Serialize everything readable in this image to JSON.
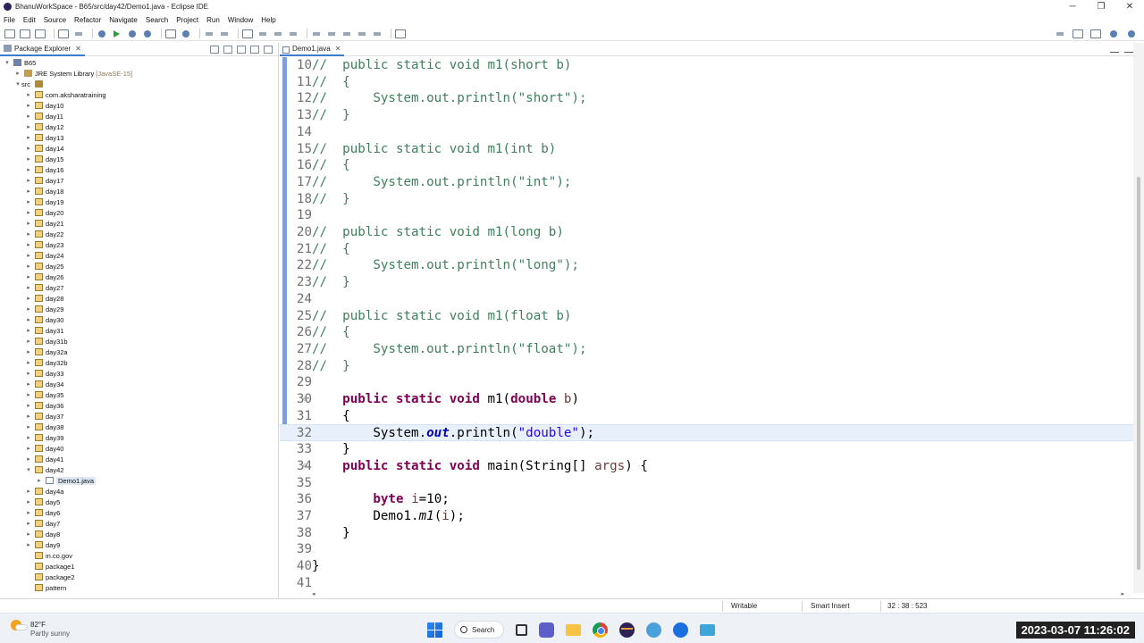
{
  "window": {
    "title": "BhanuWorkSpace - B65/src/day42/Demo1.java - Eclipse IDE",
    "controls": [
      "─",
      "❐",
      "✕"
    ]
  },
  "menu": [
    "File",
    "Edit",
    "Source",
    "Refactor",
    "Navigate",
    "Search",
    "Project",
    "Run",
    "Window",
    "Help"
  ],
  "explorer": {
    "tab_label": "Package Explorer",
    "close": "✕",
    "tree": [
      {
        "label": "B65",
        "depth": 0,
        "icon": "project",
        "arrow": "▾"
      },
      {
        "label": "JRE System Library",
        "suffix": "[JavaSE-15]",
        "depth": 1,
        "icon": "library",
        "arrow": "▸"
      },
      {
        "label": "src",
        "depth": 1,
        "icon": "source-folder",
        "arrow": "▾"
      },
      {
        "label": "com.aksharatraining",
        "depth": 2,
        "icon": "package",
        "arrow": "▸"
      },
      {
        "label": "day10",
        "depth": 2,
        "icon": "package",
        "arrow": "▸"
      },
      {
        "label": "day11",
        "depth": 2,
        "icon": "package",
        "arrow": "▸"
      },
      {
        "label": "day12",
        "depth": 2,
        "icon": "package",
        "arrow": "▸"
      },
      {
        "label": "day13",
        "depth": 2,
        "icon": "package",
        "arrow": "▸"
      },
      {
        "label": "day14",
        "depth": 2,
        "icon": "package",
        "arrow": "▸"
      },
      {
        "label": "day15",
        "depth": 2,
        "icon": "package",
        "arrow": "▸"
      },
      {
        "label": "day16",
        "depth": 2,
        "icon": "package",
        "arrow": "▸"
      },
      {
        "label": "day17",
        "depth": 2,
        "icon": "package",
        "arrow": "▸"
      },
      {
        "label": "day18",
        "depth": 2,
        "icon": "package",
        "arrow": "▸"
      },
      {
        "label": "day19",
        "depth": 2,
        "icon": "package",
        "arrow": "▸"
      },
      {
        "label": "day20",
        "depth": 2,
        "icon": "package",
        "arrow": "▸"
      },
      {
        "label": "day21",
        "depth": 2,
        "icon": "package",
        "arrow": "▸"
      },
      {
        "label": "day22",
        "depth": 2,
        "icon": "package",
        "arrow": "▸"
      },
      {
        "label": "day23",
        "depth": 2,
        "icon": "package",
        "arrow": "▸"
      },
      {
        "label": "day24",
        "depth": 2,
        "icon": "package",
        "arrow": "▸"
      },
      {
        "label": "day25",
        "depth": 2,
        "icon": "package",
        "arrow": "▸"
      },
      {
        "label": "day26",
        "depth": 2,
        "icon": "package",
        "arrow": "▸"
      },
      {
        "label": "day27",
        "depth": 2,
        "icon": "package",
        "arrow": "▸"
      },
      {
        "label": "day28",
        "depth": 2,
        "icon": "package",
        "arrow": "▸"
      },
      {
        "label": "day29",
        "depth": 2,
        "icon": "package",
        "arrow": "▸"
      },
      {
        "label": "day30",
        "depth": 2,
        "icon": "package",
        "arrow": "▸"
      },
      {
        "label": "day31",
        "depth": 2,
        "icon": "package",
        "arrow": "▸"
      },
      {
        "label": "day31b",
        "depth": 2,
        "icon": "package",
        "arrow": "▸"
      },
      {
        "label": "day32a",
        "depth": 2,
        "icon": "package",
        "arrow": "▸"
      },
      {
        "label": "day32b",
        "depth": 2,
        "icon": "package",
        "arrow": "▸"
      },
      {
        "label": "day33",
        "depth": 2,
        "icon": "package",
        "arrow": "▸"
      },
      {
        "label": "day34",
        "depth": 2,
        "icon": "package",
        "arrow": "▸"
      },
      {
        "label": "day35",
        "depth": 2,
        "icon": "package",
        "arrow": "▸"
      },
      {
        "label": "day36",
        "depth": 2,
        "icon": "package",
        "arrow": "▸"
      },
      {
        "label": "day37",
        "depth": 2,
        "icon": "package",
        "arrow": "▸"
      },
      {
        "label": "day38",
        "depth": 2,
        "icon": "package",
        "arrow": "▸"
      },
      {
        "label": "day39",
        "depth": 2,
        "icon": "package",
        "arrow": "▸"
      },
      {
        "label": "day40",
        "depth": 2,
        "icon": "package",
        "arrow": "▸"
      },
      {
        "label": "day41",
        "depth": 2,
        "icon": "package",
        "arrow": "▸"
      },
      {
        "label": "day42",
        "depth": 2,
        "icon": "package",
        "arrow": "▾"
      },
      {
        "label": "Demo1.java",
        "depth": 3,
        "icon": "java-file",
        "arrow": "▸",
        "selected": true
      },
      {
        "label": "day4a",
        "depth": 2,
        "icon": "package",
        "arrow": "▸"
      },
      {
        "label": "day5",
        "depth": 2,
        "icon": "package",
        "arrow": "▸"
      },
      {
        "label": "day6",
        "depth": 2,
        "icon": "package",
        "arrow": "▸"
      },
      {
        "label": "day7",
        "depth": 2,
        "icon": "package",
        "arrow": "▸"
      },
      {
        "label": "day8",
        "depth": 2,
        "icon": "package",
        "arrow": "▸"
      },
      {
        "label": "day9",
        "depth": 2,
        "icon": "package",
        "arrow": "▸"
      },
      {
        "label": "in.co.gov",
        "depth": 2,
        "icon": "package",
        "arrow": ""
      },
      {
        "label": "package1",
        "depth": 2,
        "icon": "package",
        "arrow": ""
      },
      {
        "label": "package2",
        "depth": 2,
        "icon": "package",
        "arrow": ""
      },
      {
        "label": "pattern",
        "depth": 2,
        "icon": "package",
        "arrow": ""
      }
    ]
  },
  "editor": {
    "tab_label": "Demo1.java",
    "close": "✕",
    "current_line": 32,
    "lines": [
      {
        "n": "10",
        "tokens": [
          [
            "cm",
            "//  public static void m1(short b)"
          ]
        ]
      },
      {
        "n": "11",
        "tokens": [
          [
            "cm",
            "//  {"
          ]
        ]
      },
      {
        "n": "12",
        "tokens": [
          [
            "cm",
            "//      System.out.println(\"short\");"
          ]
        ]
      },
      {
        "n": "13",
        "tokens": [
          [
            "cm",
            "//  }"
          ]
        ]
      },
      {
        "n": "14",
        "tokens": []
      },
      {
        "n": "15",
        "tokens": [
          [
            "cm",
            "//  public static void m1(int b)"
          ]
        ]
      },
      {
        "n": "16",
        "tokens": [
          [
            "cm",
            "//  {"
          ]
        ]
      },
      {
        "n": "17",
        "tokens": [
          [
            "cm",
            "//      System.out.println(\"int\");"
          ]
        ]
      },
      {
        "n": "18",
        "tokens": [
          [
            "cm",
            "//  }"
          ]
        ]
      },
      {
        "n": "19",
        "tokens": []
      },
      {
        "n": "20",
        "tokens": [
          [
            "cm",
            "//  public static void m1(long b)"
          ]
        ]
      },
      {
        "n": "21",
        "tokens": [
          [
            "cm",
            "//  {"
          ]
        ]
      },
      {
        "n": "22",
        "tokens": [
          [
            "cm",
            "//      System.out.println(\"long\");"
          ]
        ]
      },
      {
        "n": "23",
        "tokens": [
          [
            "cm",
            "//  }"
          ]
        ]
      },
      {
        "n": "24",
        "tokens": []
      },
      {
        "n": "25",
        "tokens": [
          [
            "cm",
            "//  public static void m1(float b)"
          ]
        ]
      },
      {
        "n": "26",
        "tokens": [
          [
            "cm",
            "//  {"
          ]
        ]
      },
      {
        "n": "27",
        "tokens": [
          [
            "cm",
            "//      System.out.println(\"float\");"
          ]
        ]
      },
      {
        "n": "28",
        "tokens": [
          [
            "cm",
            "//  }"
          ]
        ]
      },
      {
        "n": "29",
        "tokens": []
      },
      {
        "n": "30",
        "fold": "⊖",
        "tokens": [
          [
            "",
            "    "
          ],
          [
            "kw",
            "public"
          ],
          [
            "",
            " "
          ],
          [
            "kw",
            "static"
          ],
          [
            "",
            " "
          ],
          [
            "kw",
            "void"
          ],
          [
            "",
            " m1("
          ],
          [
            "kw",
            "double"
          ],
          [
            "",
            " "
          ],
          [
            "pv",
            "b"
          ],
          [
            "",
            ")"
          ]
        ]
      },
      {
        "n": "31",
        "tokens": [
          [
            "",
            "    {"
          ]
        ]
      },
      {
        "n": "32",
        "tokens": [
          [
            "",
            "        System."
          ],
          [
            "fld",
            "out"
          ],
          [
            "",
            ".println("
          ],
          [
            "st",
            "\"double\""
          ],
          [
            "",
            ");"
          ]
        ]
      },
      {
        "n": "33",
        "tokens": [
          [
            "",
            "    }"
          ]
        ]
      },
      {
        "n": "34",
        "fold": "⊖",
        "tokens": [
          [
            "",
            "    "
          ],
          [
            "kw",
            "public"
          ],
          [
            "",
            " "
          ],
          [
            "kw",
            "static"
          ],
          [
            "",
            " "
          ],
          [
            "kw",
            "void"
          ],
          [
            "",
            " main(String[] "
          ],
          [
            "pv",
            "args"
          ],
          [
            "",
            ") {"
          ]
        ]
      },
      {
        "n": "35",
        "tokens": []
      },
      {
        "n": "36",
        "tokens": [
          [
            "",
            "        "
          ],
          [
            "kw",
            "byte"
          ],
          [
            "",
            " "
          ],
          [
            "pv",
            "i"
          ],
          [
            "",
            "=10;"
          ]
        ]
      },
      {
        "n": "37",
        "tokens": [
          [
            "",
            "        Demo1."
          ],
          [
            "it",
            "m1"
          ],
          [
            "",
            "("
          ],
          [
            "pv",
            "i"
          ],
          [
            "",
            ");"
          ]
        ]
      },
      {
        "n": "38",
        "tokens": [
          [
            "",
            "    }"
          ]
        ]
      },
      {
        "n": "39",
        "tokens": []
      },
      {
        "n": "40",
        "tokens": [
          [
            "",
            "}"
          ]
        ]
      },
      {
        "n": "41",
        "tokens": []
      }
    ]
  },
  "statusbar": {
    "writable": "Writable",
    "insert_mode": "Smart Insert",
    "position": "32 : 38 : 523"
  },
  "taskbar": {
    "weather_temp": "82°F",
    "weather_desc": "Partly sunny",
    "search_label": "Search",
    "clock": "2023-03-07 11:26:02"
  }
}
